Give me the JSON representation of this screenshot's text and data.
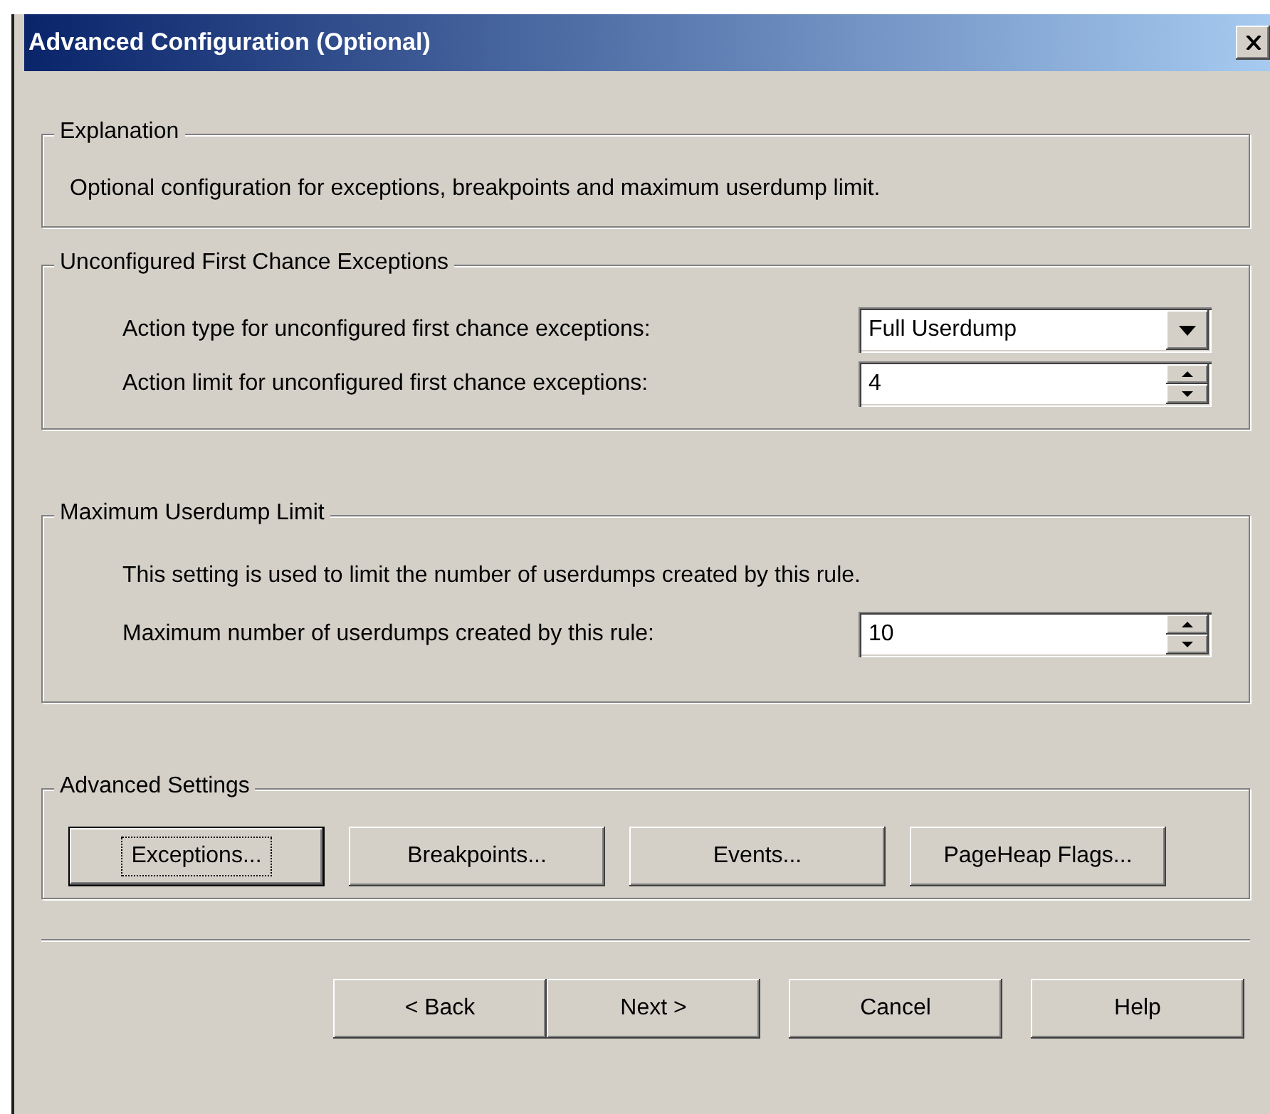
{
  "window": {
    "title": "Advanced Configuration (Optional)"
  },
  "explanation": {
    "title": "Explanation",
    "text": "Optional configuration for exceptions, breakpoints and maximum userdump limit."
  },
  "unconfigured_first_chance_exceptions": {
    "title": "Unconfigured First Chance Exceptions",
    "fields": [
      {
        "kind": "dropdown",
        "label": "Action type for unconfigured first chance exceptions:",
        "value": "Full Userdump"
      },
      {
        "kind": "spinner",
        "label": "Action limit for unconfigured first chance exceptions:",
        "value": "4"
      }
    ]
  },
  "maximum_userdump_limit": {
    "title": "Maximum Userdump Limit",
    "description": "This setting is used to limit the number of userdumps created by this rule.",
    "fields": [
      {
        "kind": "spinner",
        "label": "Maximum number of userdumps created by this rule:",
        "value": "10"
      }
    ]
  },
  "advanced_settings": {
    "title": "Advanced Settings",
    "buttons": [
      {
        "label": "Exceptions...",
        "focused": true
      },
      {
        "label": "Breakpoints...",
        "focused": false
      },
      {
        "label": "Events...",
        "focused": false
      },
      {
        "label": "PageHeap Flags...",
        "focused": false
      }
    ]
  },
  "footer_buttons": [
    {
      "label": "< Back"
    },
    {
      "label": "Next >"
    },
    {
      "label": "Cancel"
    },
    {
      "label": "Help"
    }
  ]
}
